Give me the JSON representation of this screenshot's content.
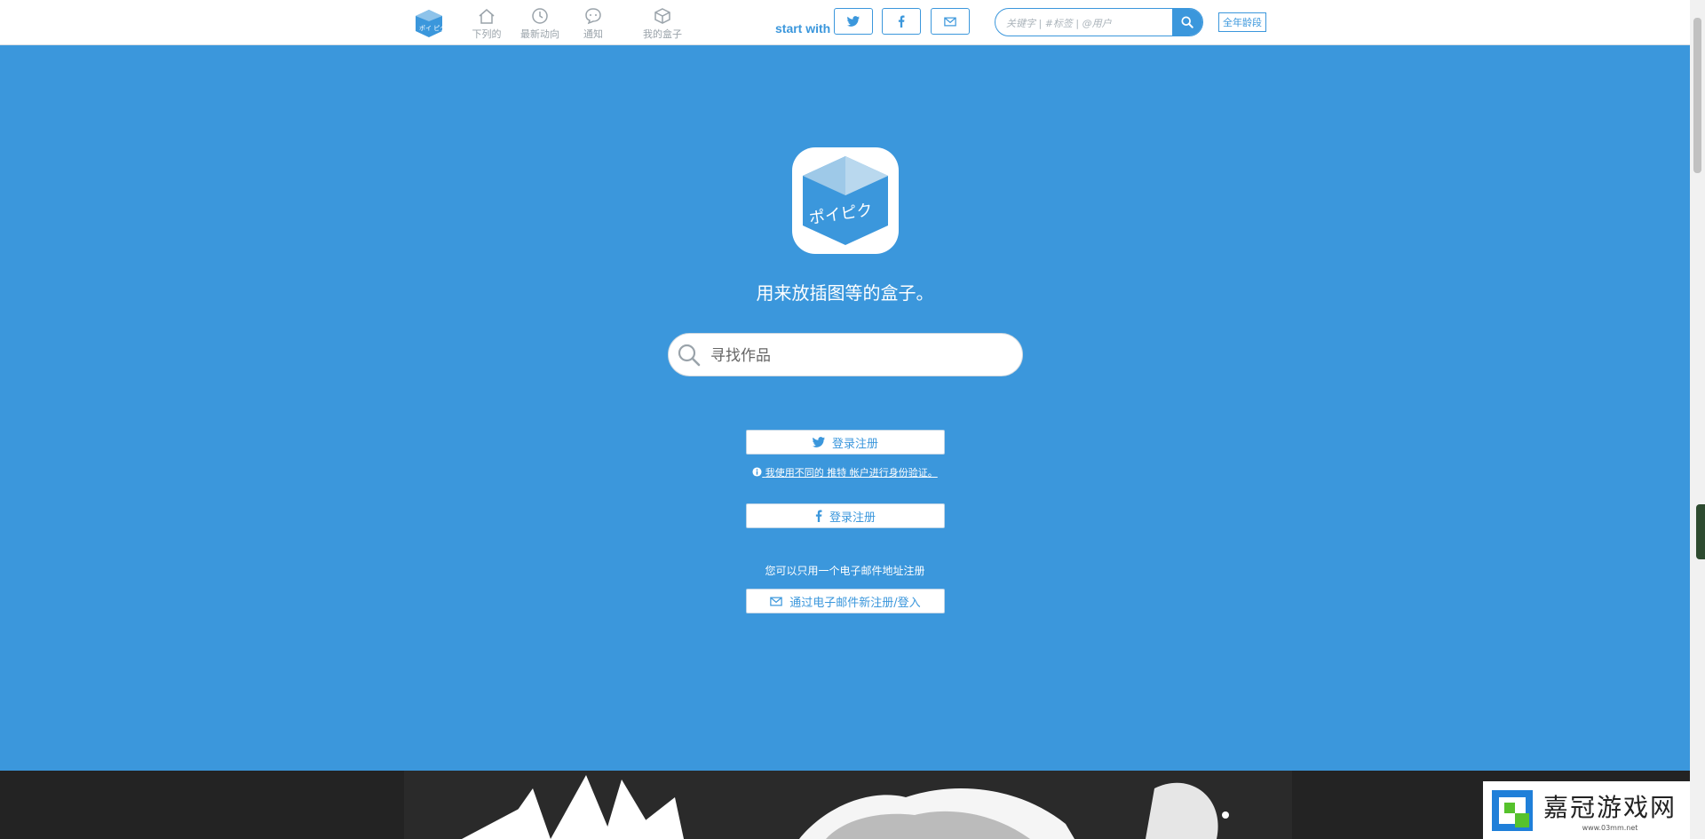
{
  "header": {
    "nav": [
      {
        "label": "下列的",
        "icon": "home-icon"
      },
      {
        "label": "最新动向",
        "icon": "clock-icon"
      },
      {
        "label": "通知",
        "icon": "chat-icon"
      },
      {
        "label": "我的盒子",
        "icon": "box-icon"
      }
    ],
    "start_with": "start with",
    "share": [
      {
        "icon": "twitter-icon"
      },
      {
        "icon": "facebook-icon"
      },
      {
        "icon": "mail-icon"
      }
    ],
    "search_placeholder": "关键字 | #标签 | @用户",
    "age_badge": "全年龄段"
  },
  "hero": {
    "logo_text": "ポイピク",
    "tagline": "用来放插图等的盒子。",
    "search_placeholder": "寻找作品",
    "twitter_login": "登录注册",
    "twitter_note": "我使用不同的 推特 帐户进行身份验证。",
    "facebook_login": "登录注册",
    "email_note": "您可以只用一个电子邮件地址注册",
    "email_login": "通过电子邮件新注册/登入"
  },
  "watermark": {
    "title": "嘉冠游戏网",
    "url": "www.03mm.net"
  },
  "colors": {
    "brand": "#3b97dc",
    "header_bg": "#ffffff",
    "footer_bg": "#232323"
  }
}
